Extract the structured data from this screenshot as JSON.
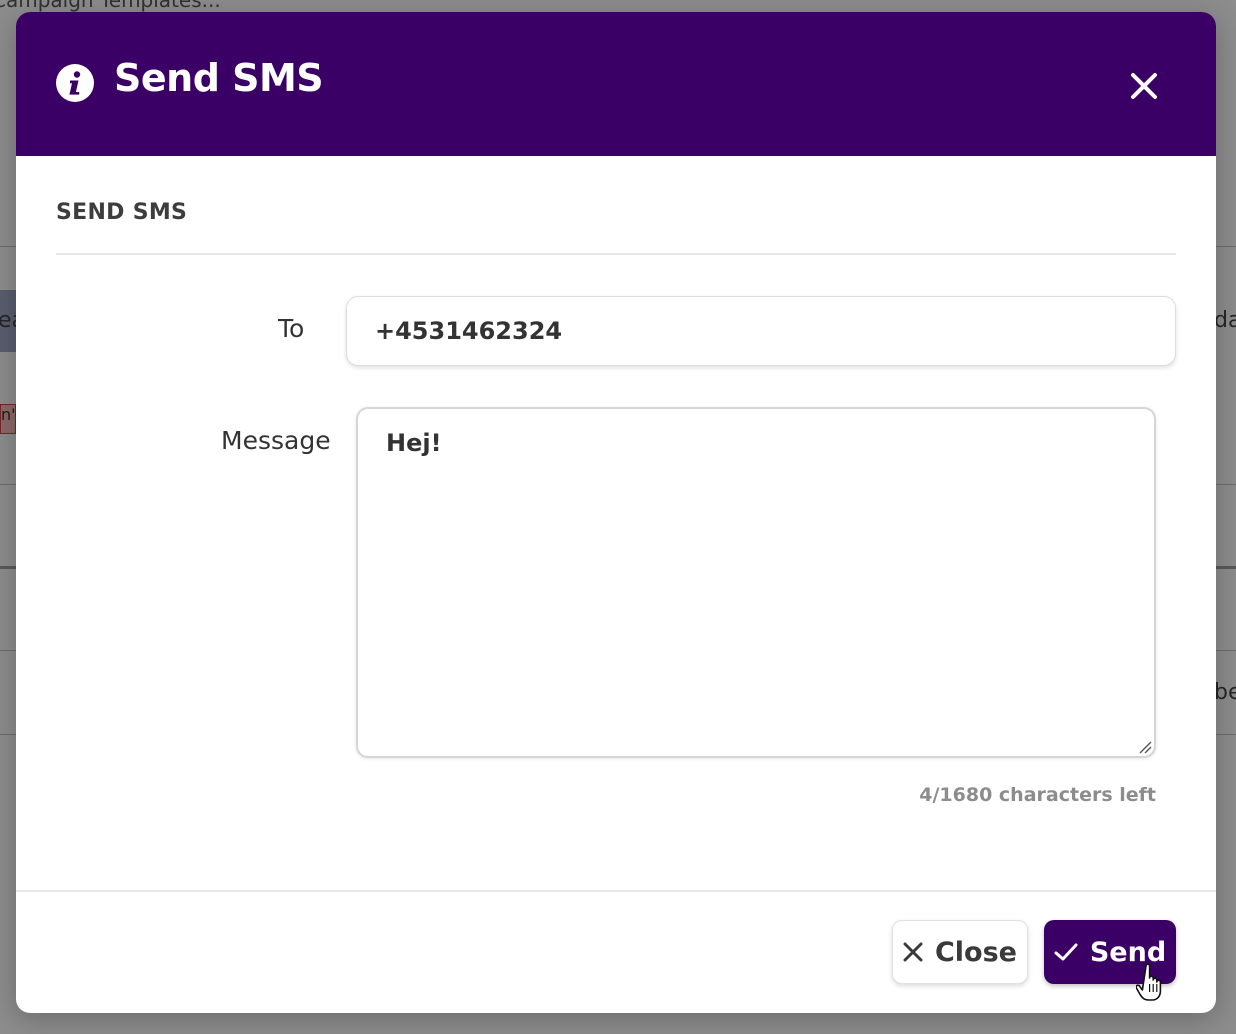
{
  "background": {
    "top_text": "Campaign Templates...",
    "fragment_1": "ea",
    "fragment_2": "da",
    "fragment_3": "n's",
    "fragment_4": "be"
  },
  "modal": {
    "title": "Send SMS",
    "header_icon": "info-icon",
    "close_icon": "close-icon",
    "accent_color": "#3b0066",
    "section_title": "SEND SMS",
    "to_label": "To",
    "to_value": "+4531462324",
    "message_label": "Message",
    "message_value": "Hej!",
    "char_count": "4/1680 characters left",
    "close_button_label": "Close",
    "close_button_icon": "x-icon",
    "send_button_label": "Send",
    "send_button_icon": "check-icon"
  }
}
